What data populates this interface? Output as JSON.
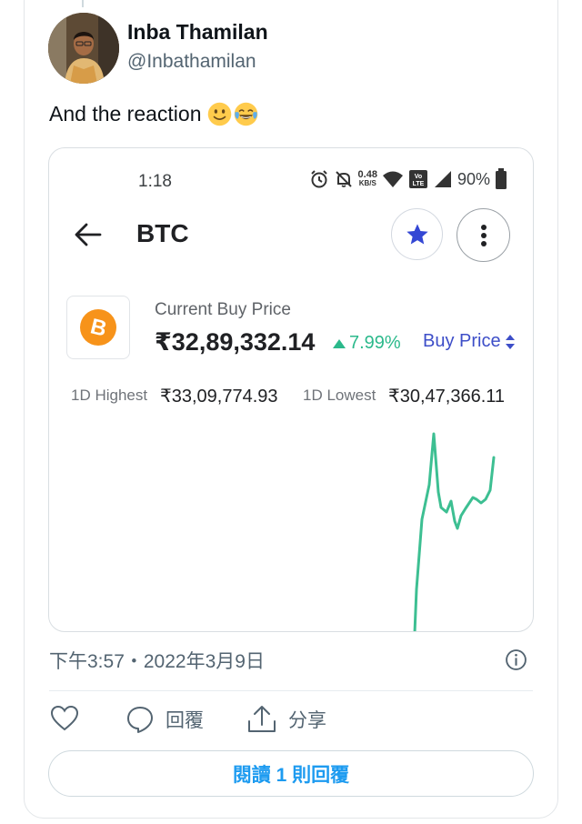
{
  "tweet": {
    "author_name": "Inba Thamilan",
    "author_handle": "@Inbathamilan",
    "text": "And the reaction",
    "emojis": [
      "slightly-smiling-face",
      "face-with-tears-of-joy"
    ],
    "timestamp": "下午3:57・2022年3月9日"
  },
  "screenshot": {
    "status_bar": {
      "time": "1:18",
      "net_speed_value": "0.48",
      "net_speed_unit": "KB/S",
      "battery": "90%"
    },
    "header": {
      "title": "BTC"
    },
    "price": {
      "label": "Current Buy Price",
      "value": "₹32,89,332.14",
      "change": "7.99%",
      "buy_price_label": "Buy Price"
    },
    "range": {
      "high_label": "1D Highest",
      "high_value": "₹33,09,774.93",
      "low_label": "1D Lowest",
      "low_value": "₹30,47,366.11"
    },
    "colors": {
      "line": "#3dbf92",
      "accent": "#3d4ec8",
      "coin": "#f7931a"
    }
  },
  "actions": {
    "like_icon": "heart-icon",
    "reply_label": "回覆",
    "share_label": "分享",
    "read_replies_label": "閱讀 1 則回覆"
  }
}
